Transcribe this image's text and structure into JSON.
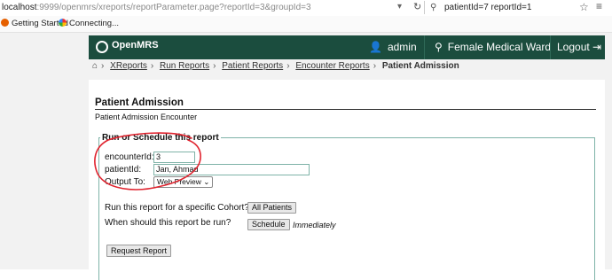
{
  "browser": {
    "url_host": "localhost",
    "url_rest": ":9999/openmrs/xreports/reportParameter.page?reportId=3&groupId=3",
    "search_text": "patientId=7 reportId=1",
    "bookmarks": [
      "Getting Started",
      "Connecting..."
    ]
  },
  "header": {
    "logo_text": "OpenMRS",
    "user": "admin",
    "location": "Female Medical Ward",
    "logout": "Logout"
  },
  "breadcrumb": {
    "items": [
      "XReports",
      "Run Reports",
      "Patient Reports",
      "Encounter Reports"
    ],
    "current": "Patient Admission"
  },
  "report": {
    "title": "Patient Admission",
    "description": "Patient Admission Encounter",
    "legend": "Run or Schedule this report",
    "fields": {
      "encounter_label": "encounterId:",
      "encounter_value": "3",
      "patient_label": "patientId:",
      "patient_value": "Jan, Ahmad",
      "output_label": "Output To:",
      "output_value": "Web Preview"
    },
    "cohort_text": "Run this report for a specific Cohort?",
    "cohort_button": "All Patients",
    "schedule_text": "When should this report be run?",
    "schedule_button": "Schedule",
    "schedule_value": "Immediately",
    "request_button": "Request Report"
  },
  "colors": {
    "header_bg": "#1b4d3e",
    "annotation": "#e0242f"
  },
  "icons": [
    "dropdown-icon",
    "reload-icon",
    "search-icon",
    "bookmark-star-icon",
    "more-icon",
    "firefox-icon",
    "openmrs-icon",
    "home-icon",
    "user-icon",
    "location-pin-icon",
    "logout-icon"
  ]
}
